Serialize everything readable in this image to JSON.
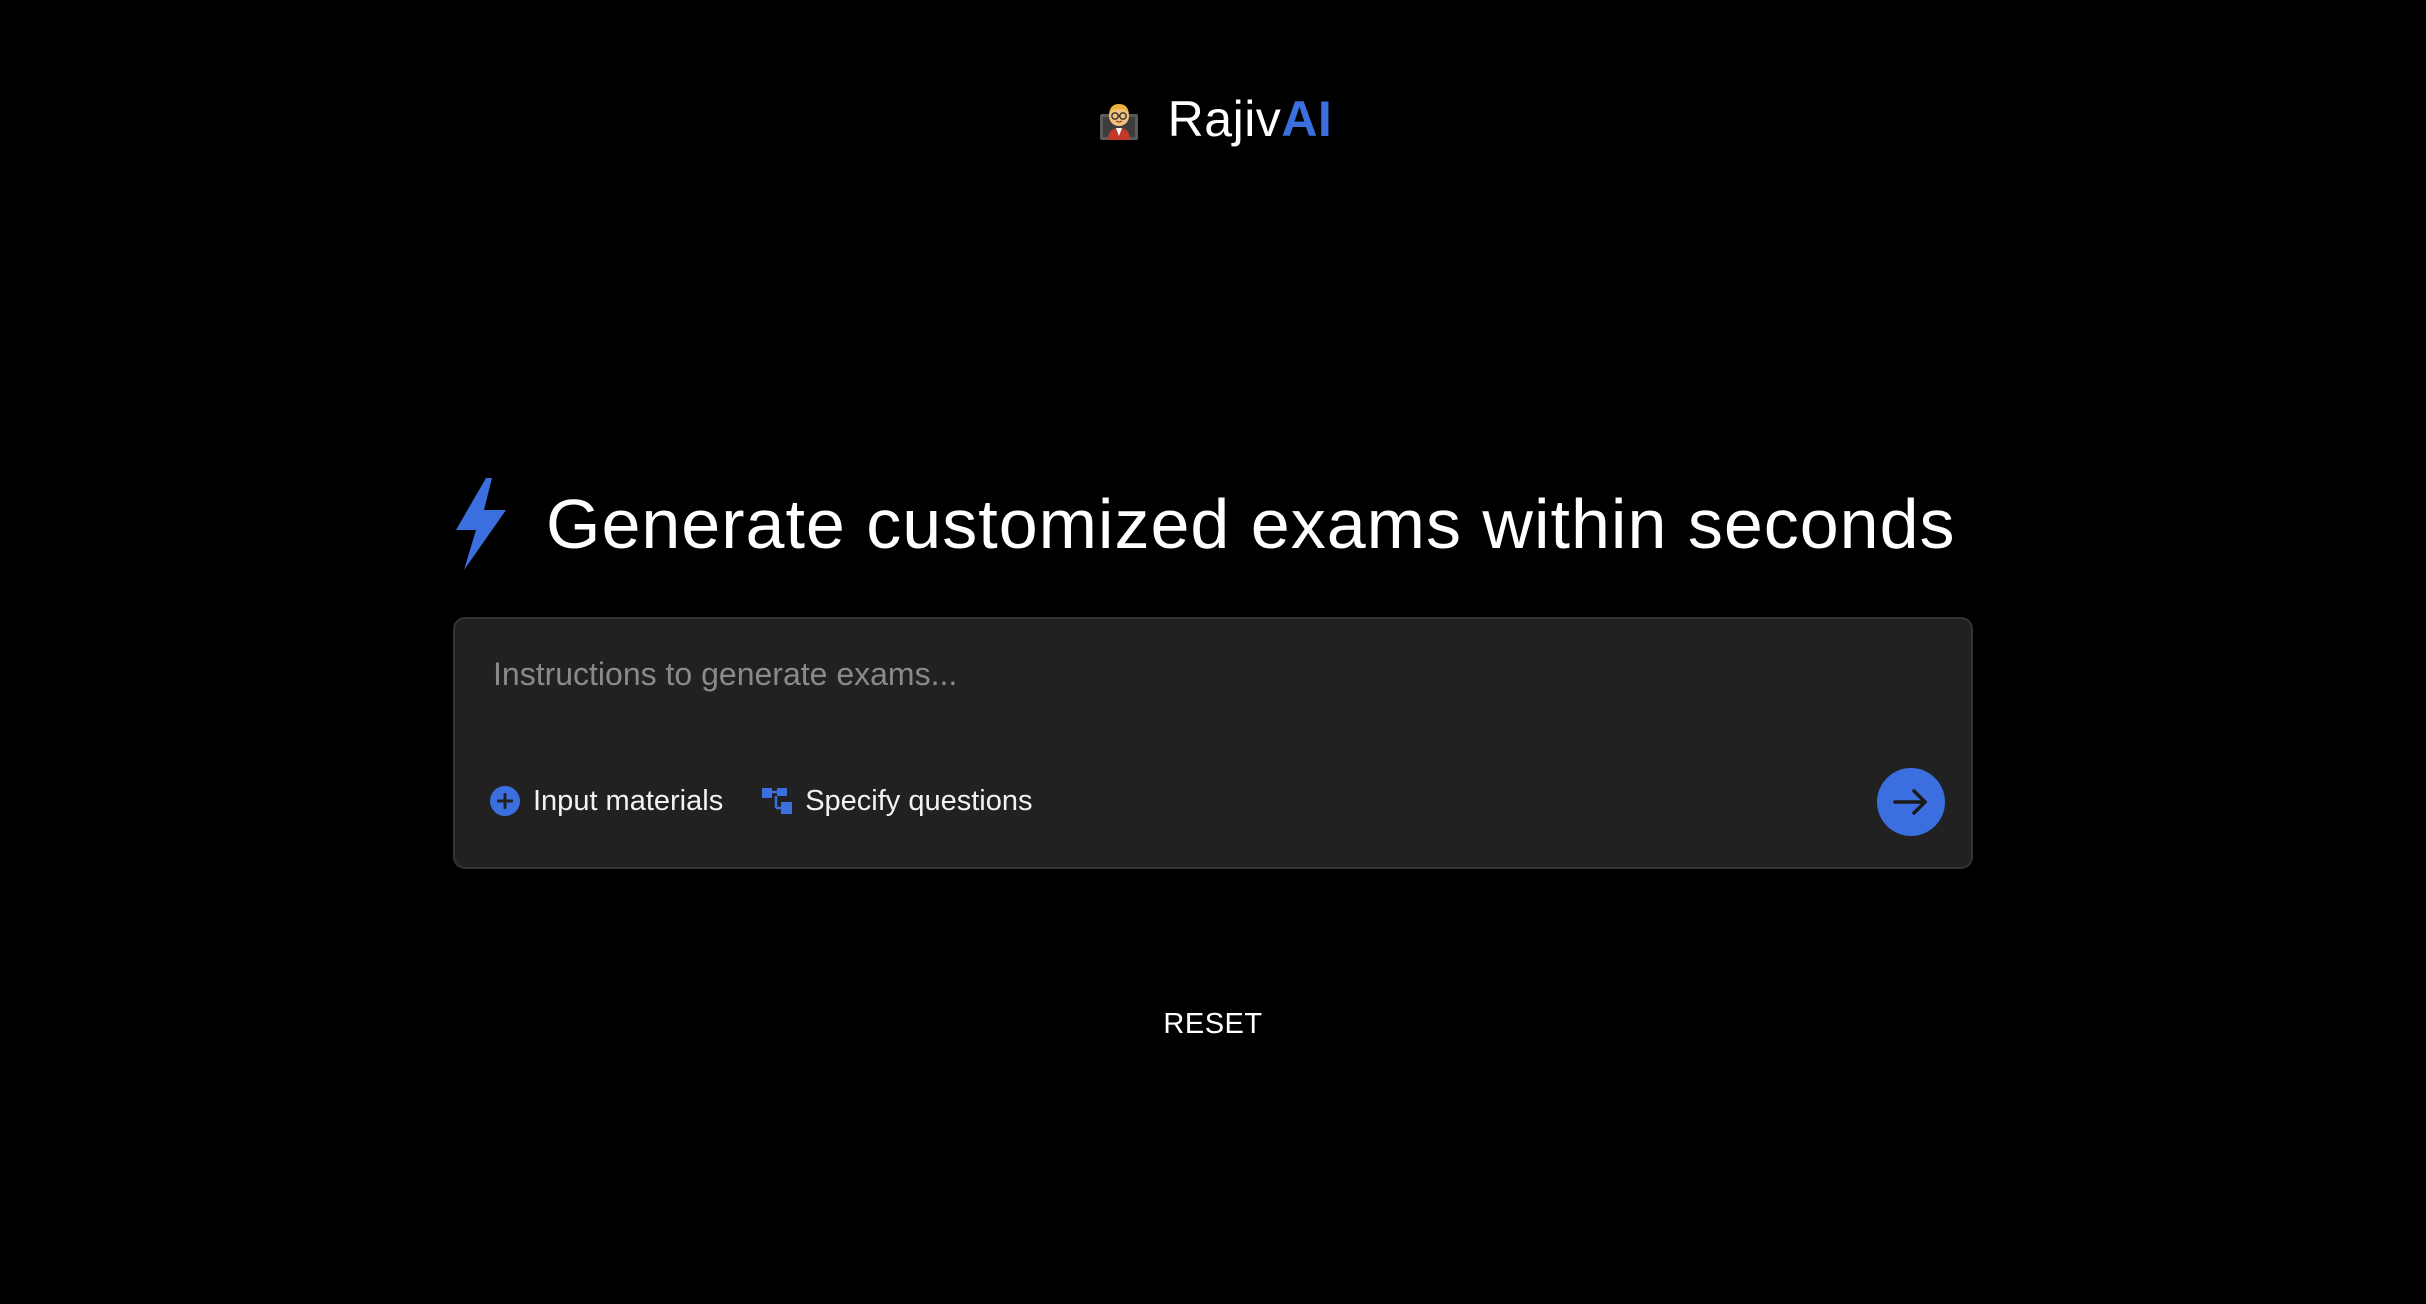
{
  "brand": {
    "logo_icon": "teacher-emoji-icon",
    "name_prefix": "Rajiv",
    "name_suffix": "AI",
    "accent_color": "#3b6fe0"
  },
  "headline": {
    "icon": "lightning-bolt-icon",
    "text": "Generate customized exams within seconds"
  },
  "prompt": {
    "placeholder": "Instructions to generate exams...",
    "value": "",
    "actions": [
      {
        "icon": "plus-circle-icon",
        "label": "Input materials"
      },
      {
        "icon": "tree-structure-icon",
        "label": "Specify questions"
      }
    ],
    "submit_icon": "arrow-right-icon"
  },
  "reset": {
    "label": "RESET"
  }
}
